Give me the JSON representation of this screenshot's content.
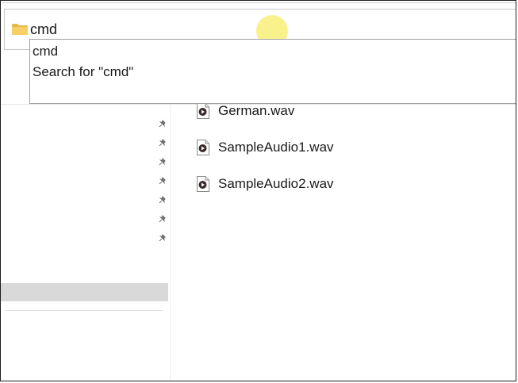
{
  "address_bar": {
    "value": "cmd",
    "folder_icon": "folder-icon"
  },
  "autocomplete": {
    "items": [
      {
        "label": "cmd"
      },
      {
        "label": "Search for \"cmd\""
      }
    ]
  },
  "navigation_pane": {
    "pin_icon": "pin-icon",
    "selected_color": "#d9d9d9"
  },
  "files": [
    {
      "name": "German.wav",
      "icon": "audio-file-icon"
    },
    {
      "name": "SampleAudio1.wav",
      "icon": "audio-file-icon"
    },
    {
      "name": "SampleAudio2.wav",
      "icon": "audio-file-icon"
    }
  ],
  "colors": {
    "cursor_highlight": "#f8f078",
    "folder": "#f2c55c",
    "audio_badge": "#3a2a2a"
  }
}
